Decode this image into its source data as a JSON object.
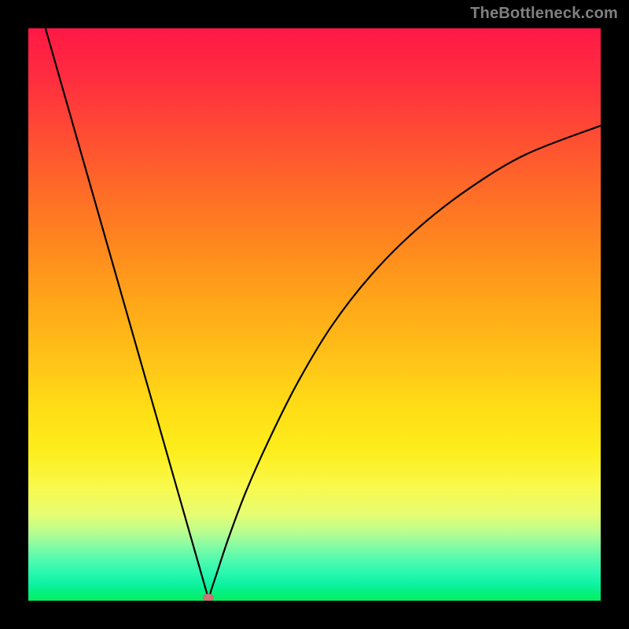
{
  "watermark": "TheBottleneck.com",
  "colors": {
    "dot": "#cb7376"
  },
  "chart_data": {
    "type": "line",
    "title": "",
    "xlabel": "",
    "ylabel": "",
    "xlim": [
      0,
      100
    ],
    "ylim": [
      0,
      100
    ],
    "gradient": "red-top to green-bottom",
    "minimum_at_x": 31.5,
    "series": [
      {
        "name": "bottleneck-curve",
        "x": [
          3,
          5,
          8,
          11,
          14,
          17,
          20,
          23,
          26,
          28,
          30,
          31,
          31.5,
          32,
          33,
          35,
          38,
          42,
          47,
          53,
          60,
          68,
          77,
          87,
          100
        ],
        "y": [
          100,
          93,
          82.5,
          72,
          61.5,
          51,
          40.5,
          30,
          19.5,
          12.5,
          5.5,
          2,
          0.5,
          2,
          5,
          11,
          19,
          28,
          38,
          48,
          57,
          65,
          72,
          78,
          83
        ]
      }
    ],
    "marker": {
      "x": 31.5,
      "y": 0.5,
      "color": "#cb7376",
      "shape": "ellipse"
    }
  }
}
